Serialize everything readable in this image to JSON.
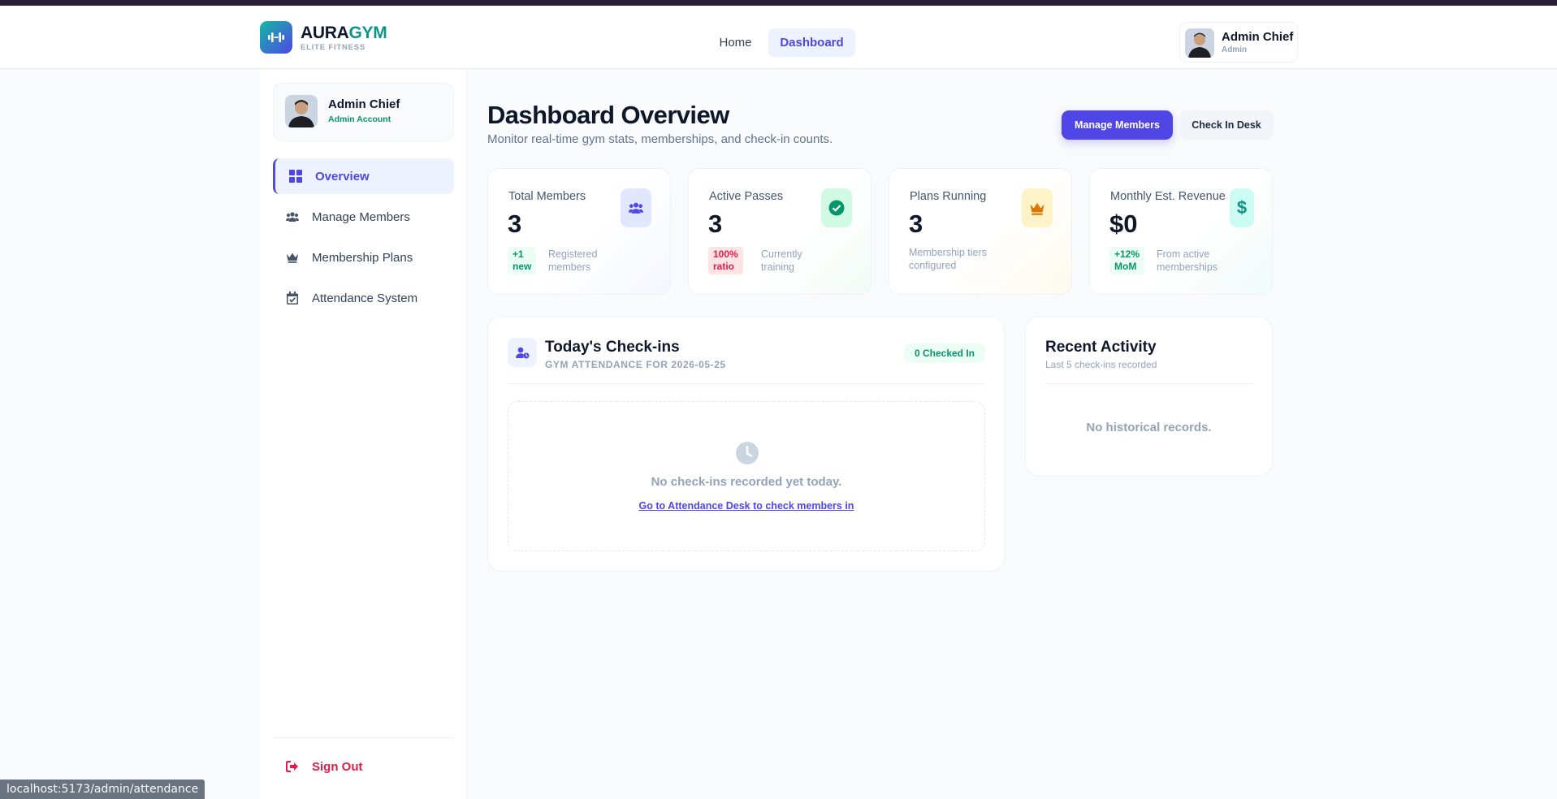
{
  "brand": {
    "name_part1": "AURA",
    "name_part2": "GYM",
    "tagline": "ELITE FITNESS",
    "accent": "#0d9488",
    "primary": "#4f46e5"
  },
  "topnav": {
    "items": [
      {
        "label": "Home"
      },
      {
        "label": "Dashboard"
      }
    ]
  },
  "header_user": {
    "name": "Admin Chief",
    "role": "Admin"
  },
  "sidebar": {
    "profile": {
      "name": "Admin Chief",
      "role": "Admin Account"
    },
    "items": [
      {
        "label": "Overview",
        "icon": "grid-icon"
      },
      {
        "label": "Manage Members",
        "icon": "users-icon"
      },
      {
        "label": "Membership Plans",
        "icon": "crown-icon"
      },
      {
        "label": "Attendance System",
        "icon": "calendar-check-icon"
      }
    ],
    "sign_out": "Sign Out"
  },
  "page": {
    "title": "Dashboard Overview",
    "subtitle": "Monitor real-time gym stats, memberships, and check-in counts.",
    "actions": {
      "primary": "Manage Members",
      "secondary": "Check In Desk"
    }
  },
  "stats": [
    {
      "label": "Total Members",
      "value": "3",
      "badge_line1": "+1",
      "badge_line2": "new",
      "note_line1": "Registered",
      "note_line2": "members",
      "icon": "users-icon",
      "color": "#4f46e5"
    },
    {
      "label": "Active Passes",
      "value": "3",
      "badge_line1": "100%",
      "badge_line2": "ratio",
      "note_line1": "Currently",
      "note_line2": "training",
      "icon": "check-circle-icon",
      "color": "#059669"
    },
    {
      "label": "Plans Running",
      "value": "3",
      "note_line1": "Membership tiers",
      "note_line2": "configured",
      "icon": "crown-icon",
      "color": "#d97706"
    },
    {
      "label": "Monthly Est. Revenue",
      "value": "$0",
      "badge_line1": "+12%",
      "badge_line2": "MoM",
      "note_line1": "From active",
      "note_line2": "memberships",
      "icon": "dollar-icon",
      "color": "#0d9488"
    }
  ],
  "checkins": {
    "title": "Today's Check-ins",
    "subtitle": "GYM ATTENDANCE FOR 2026-05-25",
    "badge": "0 Checked In",
    "empty_text": "No check-ins recorded yet today.",
    "empty_link": "Go to Attendance Desk to check members in"
  },
  "recent_activity": {
    "title": "Recent Activity",
    "subtitle": "Last 5 check-ins recorded",
    "empty_text": "No historical records."
  },
  "status_url": "localhost:5173/admin/attendance"
}
